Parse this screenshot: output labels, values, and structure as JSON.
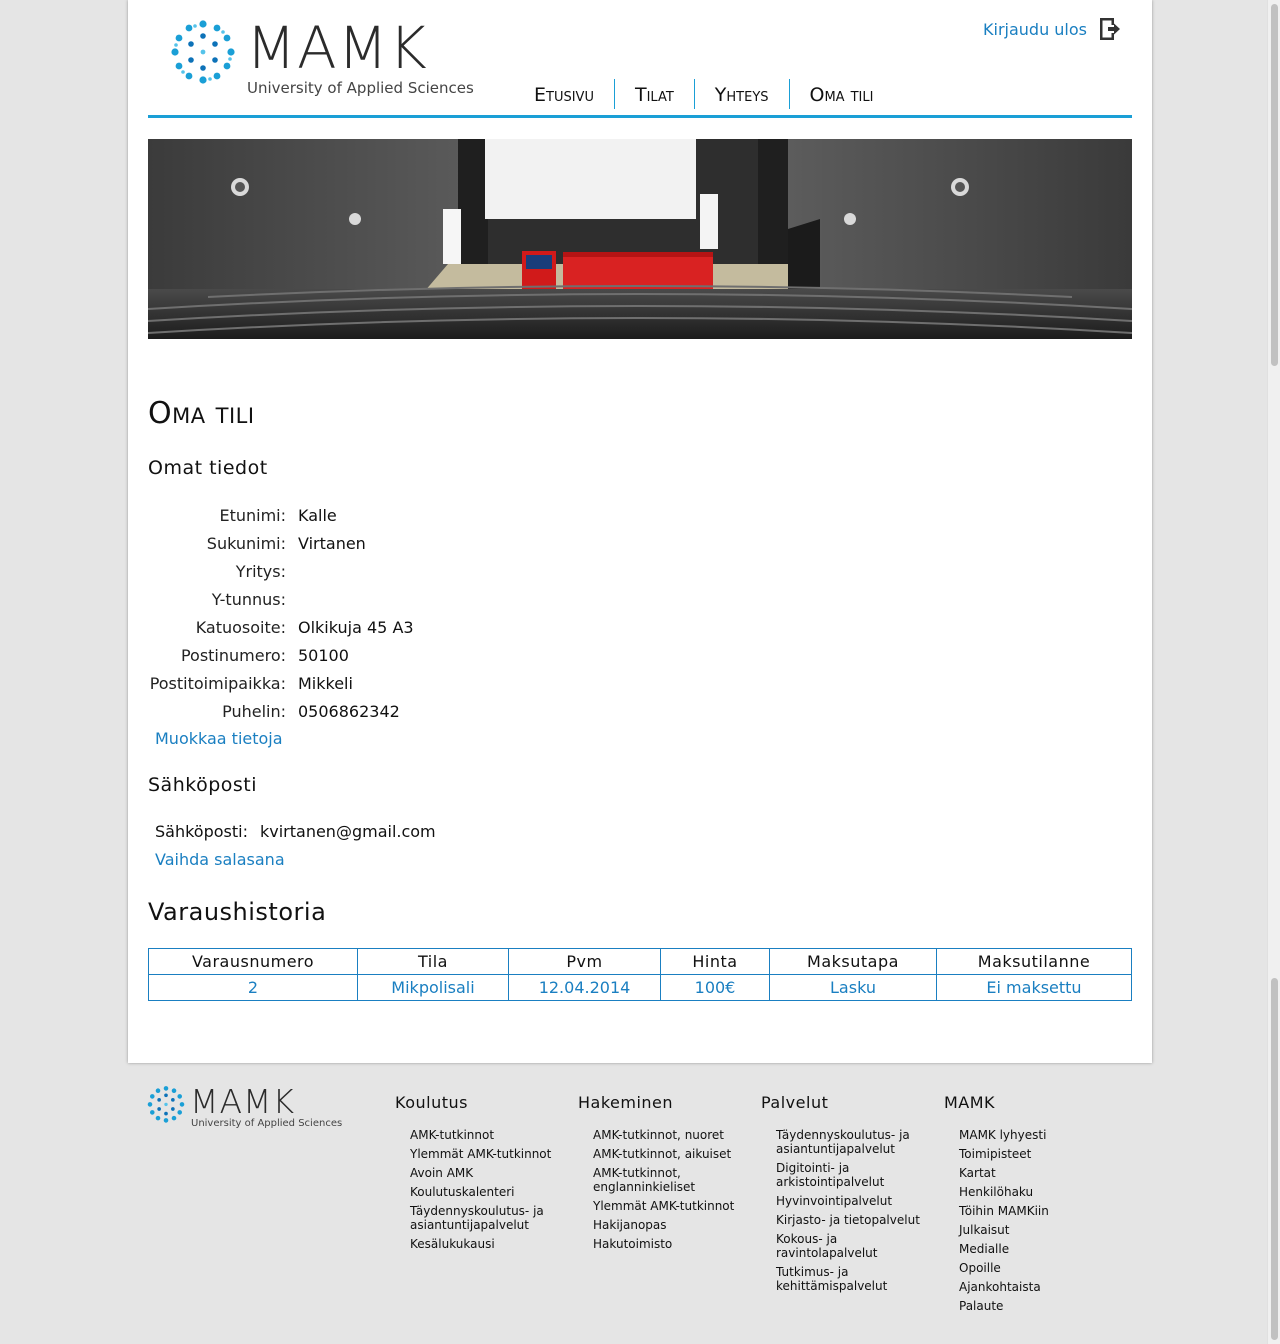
{
  "brand": {
    "name": "MAMK",
    "subtitle": "University of Applied Sciences",
    "accent_color": "#1a9fd6",
    "link_color": "#1a7fc1"
  },
  "header": {
    "logout_label": "Kirjaudu ulos",
    "logout_icon": "logout-icon",
    "nav": [
      "Etusivu",
      "Tilat",
      "Yhteys",
      "Oma tili"
    ]
  },
  "banner": {
    "icon": "lecture-hall-photo"
  },
  "main": {
    "title": "Oma tili",
    "personal_heading": "Omat tiedot",
    "fields": [
      {
        "label": "Etunimi:",
        "value": "Kalle"
      },
      {
        "label": "Sukunimi:",
        "value": "Virtanen"
      },
      {
        "label": "Yritys:",
        "value": ""
      },
      {
        "label": "Y-tunnus:",
        "value": ""
      },
      {
        "label": "Katuosoite:",
        "value": "Olkikuja 45 A3"
      },
      {
        "label": "Postinumero:",
        "value": "50100"
      },
      {
        "label": "Postitoimipaikka:",
        "value": "Mikkeli"
      },
      {
        "label": "Puhelin:",
        "value": "0506862342"
      }
    ],
    "edit_link": "Muokkaa tietoja",
    "email_heading": "Sähköposti",
    "email_label": "Sähköposti:",
    "email_value": "kvirtanen@gmail.com",
    "password_link": "Vaihda salasana",
    "history_heading": "Varaushistoria",
    "history_columns": [
      "Varausnumero",
      "Tila",
      "Pvm",
      "Hinta",
      "Maksutapa",
      "Maksutilanne"
    ],
    "history_rows": [
      [
        "2",
        "Mikpolisali",
        "12.04.2014",
        "100€",
        "Lasku",
        "Ei maksettu"
      ]
    ]
  },
  "footer": {
    "columns": [
      {
        "title": "Koulutus",
        "items": [
          "AMK-tutkinnot",
          "Ylemmät AMK-tutkinnot",
          "Avoin AMK",
          "Koulutuskalenteri",
          "Täydennyskoulutus- ja asiantuntijapalvelut",
          "Kesälukukausi"
        ]
      },
      {
        "title": "Hakeminen",
        "items": [
          "AMK-tutkinnot, nuoret",
          "AMK-tutkinnot, aikuiset",
          "AMK-tutkinnot, englanninkieliset",
          "Ylemmät AMK-tutkinnot",
          "Hakijanopas",
          "Hakutoimisto"
        ]
      },
      {
        "title": "Palvelut",
        "items": [
          "Täydennyskoulutus- ja asiantuntijapalvelut",
          "Digitointi- ja arkistointipalvelut",
          "Hyvinvointipalvelut",
          "Kirjasto- ja tietopalvelut",
          "Kokous- ja ravintolapalvelut",
          "Tutkimus- ja kehittämispalvelut"
        ]
      },
      {
        "title": "MAMK",
        "items": [
          "MAMK lyhyesti",
          "Toimipisteet",
          "Kartat",
          "Henkilöhaku",
          "Töihin MAMKiin",
          "Julkaisut",
          "Medialle",
          "Opoille",
          "Ajankohtaista",
          "Palaute"
        ]
      }
    ]
  }
}
